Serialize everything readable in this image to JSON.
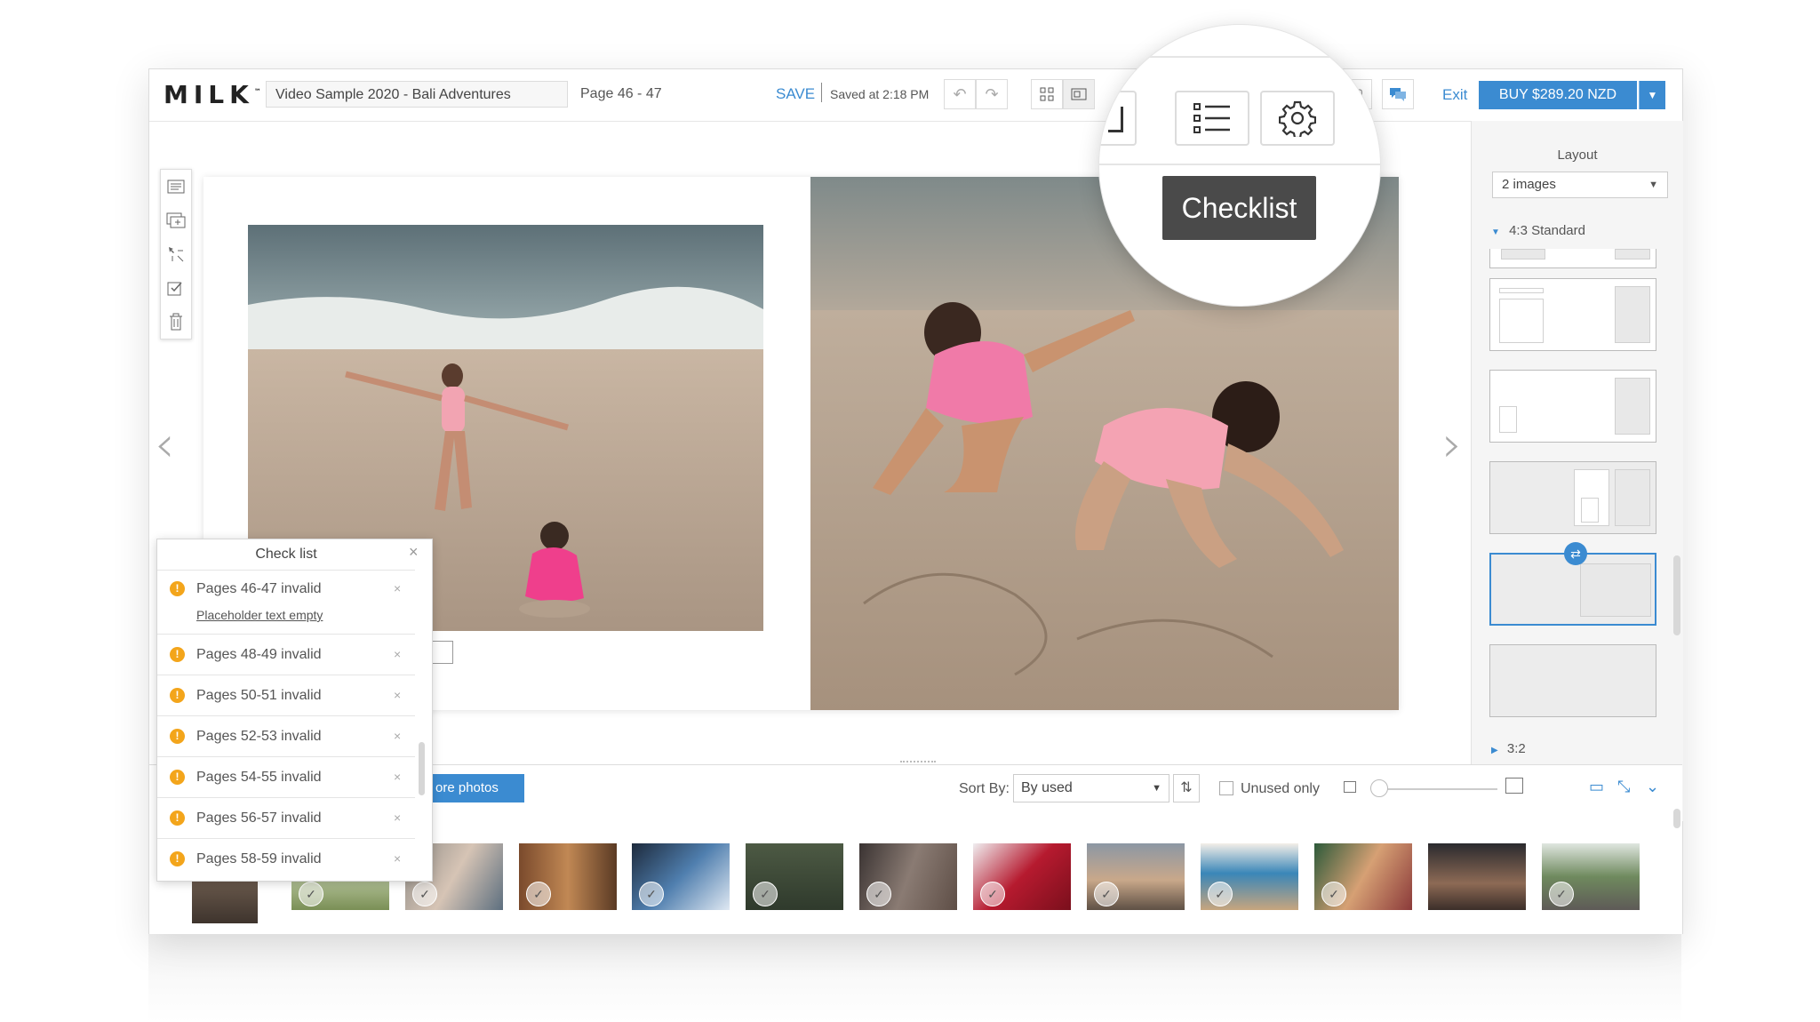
{
  "app": {
    "logo": "MILK",
    "logo_mark": "™",
    "project_title": "Video Sample 2020 - Bali Adventures",
    "page_label": "Page 46 - 47",
    "save_label": "SAVE",
    "saved_at": "Saved at 2:18 PM",
    "exit_label": "Exit",
    "buy_label": "BUY $289.20 NZD",
    "accent_color": "#3b8bd1",
    "warning_color": "#f3a51b"
  },
  "toolbar_icons": [
    "undo-icon",
    "redo-icon",
    "grid-view-icon",
    "page-view-icon",
    "comment-icon"
  ],
  "magnifier": {
    "tooltip": "Checklist",
    "buttons": [
      "checklist-icon",
      "settings-gear-icon"
    ]
  },
  "left_tools": [
    "text-icon",
    "add-page-icon",
    "move-tool-icon",
    "checklist-tool-icon",
    "trash-icon"
  ],
  "right_panel": {
    "layout_label": "Layout",
    "layout_select": "2 images",
    "section_open": "4:3 Standard",
    "section_closed": "3:2"
  },
  "checklist": {
    "title": "Check list",
    "items": [
      {
        "text": "Pages 46-47 invalid",
        "sub": "Placeholder text empty"
      },
      {
        "text": "Pages 48-49 invalid",
        "sub": ""
      },
      {
        "text": "Pages 50-51 invalid",
        "sub": ""
      },
      {
        "text": "Pages 52-53 invalid",
        "sub": ""
      },
      {
        "text": "Pages 54-55 invalid",
        "sub": ""
      },
      {
        "text": "Pages 56-57 invalid",
        "sub": ""
      },
      {
        "text": "Pages 58-59 invalid",
        "sub": ""
      }
    ],
    "dot_glyph": "!",
    "close_glyph": "×"
  },
  "tray": {
    "more_photos": "ore photos",
    "sort_by_label": "Sort By:",
    "sort_value": "By used",
    "unused_only": "Unused only",
    "check_glyph": "✓"
  }
}
